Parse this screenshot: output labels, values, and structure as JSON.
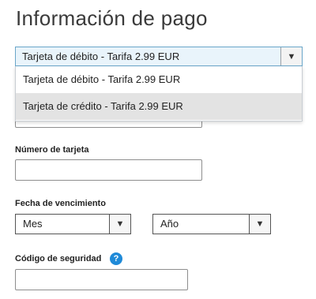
{
  "page": {
    "title": "Información de pago"
  },
  "payment_type": {
    "selected": "Tarjeta de débito - Tarifa 2.99 EUR",
    "options": [
      "Tarjeta de débito - Tarifa 2.99 EUR",
      "Tarjeta de crédito - Tarifa 2.99 EUR"
    ],
    "highlighted_option": 1
  },
  "card_number": {
    "label": "Número de tarjeta",
    "value": ""
  },
  "expiry": {
    "label": "Fecha de vencimiento",
    "month": "Mes",
    "year": "Año"
  },
  "security_code": {
    "label": "Código de seguridad",
    "help_glyph": "?",
    "value": ""
  },
  "icons": {
    "dropdown_arrow": "▼"
  },
  "colors": {
    "select_active_bg": "#e9f4fb",
    "select_active_border": "#6aa6c9",
    "option_highlight": "#e3e3e3",
    "help_icon": "#1f8ad8"
  }
}
